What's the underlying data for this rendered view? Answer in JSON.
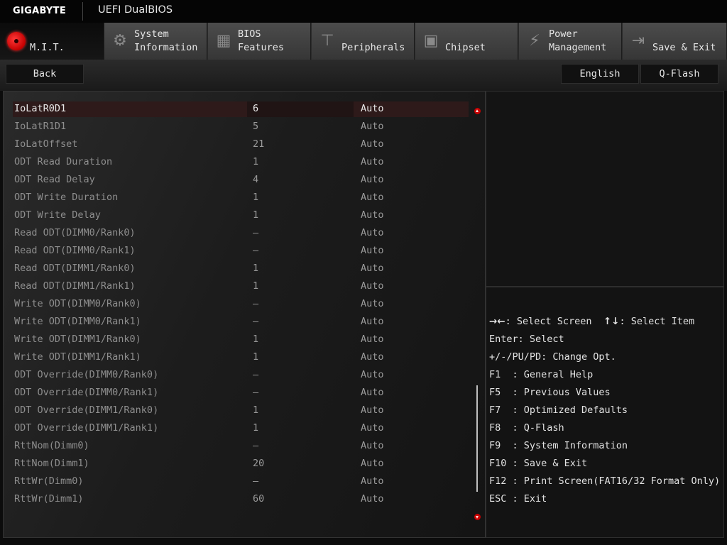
{
  "header": {
    "brand": "GIGABYTE",
    "title": "UEFI DualBIOS"
  },
  "tabs": [
    {
      "label": "M.I.T.",
      "icon": "mit-icon",
      "active": true
    },
    {
      "label": "System\nInformation",
      "icon": "gear-icon",
      "glyph": "⚙"
    },
    {
      "label": "BIOS\nFeatures",
      "icon": "chip-icon",
      "glyph": "▦"
    },
    {
      "label": "Peripherals",
      "icon": "peripherals-icon",
      "glyph": "⊤"
    },
    {
      "label": "Chipset",
      "icon": "chipset-icon",
      "glyph": "▣"
    },
    {
      "label": "Power\nManagement",
      "icon": "power-icon",
      "glyph": "⚡"
    },
    {
      "label": "Save & Exit",
      "icon": "exit-icon",
      "glyph": "⇥"
    }
  ],
  "buttons": {
    "back": "Back",
    "language": "English",
    "qflash": "Q-Flash"
  },
  "settings": [
    {
      "name": "IoLatR0D1",
      "current": "6",
      "value": "Auto"
    },
    {
      "name": "IoLatR1D1",
      "current": "5",
      "value": "Auto"
    },
    {
      "name": "IoLatOffset",
      "current": "21",
      "value": "Auto"
    },
    {
      "name": "ODT Read Duration",
      "current": "1",
      "value": "Auto"
    },
    {
      "name": "ODT Read Delay",
      "current": "4",
      "value": "Auto"
    },
    {
      "name": "ODT Write Duration",
      "current": "1",
      "value": "Auto"
    },
    {
      "name": "ODT Write Delay",
      "current": "1",
      "value": "Auto"
    },
    {
      "name": "Read ODT(DIMM0/Rank0)",
      "current": "–",
      "value": "Auto"
    },
    {
      "name": "Read ODT(DIMM0/Rank1)",
      "current": "–",
      "value": "Auto"
    },
    {
      "name": "Read ODT(DIMM1/Rank0)",
      "current": "1",
      "value": "Auto"
    },
    {
      "name": "Read ODT(DIMM1/Rank1)",
      "current": "1",
      "value": "Auto"
    },
    {
      "name": "Write ODT(DIMM0/Rank0)",
      "current": "–",
      "value": "Auto"
    },
    {
      "name": "Write ODT(DIMM0/Rank1)",
      "current": "–",
      "value": "Auto"
    },
    {
      "name": "Write ODT(DIMM1/Rank0)",
      "current": "1",
      "value": "Auto"
    },
    {
      "name": "Write ODT(DIMM1/Rank1)",
      "current": "1",
      "value": "Auto"
    },
    {
      "name": "ODT Override(DIMM0/Rank0)",
      "current": "–",
      "value": "Auto"
    },
    {
      "name": "ODT Override(DIMM0/Rank1)",
      "current": "–",
      "value": "Auto"
    },
    {
      "name": "ODT Override(DIMM1/Rank0)",
      "current": "1",
      "value": "Auto"
    },
    {
      "name": "ODT Override(DIMM1/Rank1)",
      "current": "1",
      "value": "Auto"
    },
    {
      "name": "RttNom(Dimm0)",
      "current": "–",
      "value": "Auto"
    },
    {
      "name": "RttNom(Dimm1)",
      "current": "20",
      "value": "Auto"
    },
    {
      "name": "RttWr(Dimm0)",
      "current": "–",
      "value": "Auto"
    },
    {
      "name": "RttWr(Dimm1)",
      "current": "60",
      "value": "Auto"
    }
  ],
  "selected_index": 0,
  "help": {
    "nav_arrows": "→←",
    "nav_screen": ": Select Screen",
    "nav_updown": "↑↓",
    "nav_item": ": Select Item",
    "lines": [
      "Enter: Select",
      "+/-/PU/PD: Change Opt.",
      "F1  : General Help",
      "F5  : Previous Values",
      "F7  : Optimized Defaults",
      "F8  : Q-Flash",
      "F9  : System Information",
      "F10 : Save & Exit",
      "F12 : Print Screen(FAT16/32 Format Only)",
      "ESC : Exit"
    ]
  },
  "colors": {
    "accent": "#c80000",
    "tab_bg": "#404040",
    "panel_bg": "#1a1a1a",
    "text": "#e2e2e2",
    "dim_text": "#8e8e8e"
  }
}
